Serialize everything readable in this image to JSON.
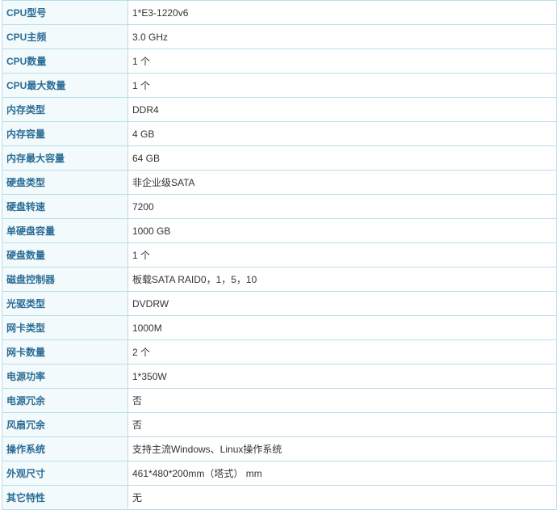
{
  "specs": [
    {
      "label": "CPU型号",
      "value": "1*E3-1220v6"
    },
    {
      "label": "CPU主频",
      "value": "3.0  GHz"
    },
    {
      "label": "CPU数量",
      "value": "1  个"
    },
    {
      "label": "CPU最大数量",
      "value": "1  个"
    },
    {
      "label": "内存类型",
      "value": "DDR4"
    },
    {
      "label": "内存容量",
      "value": "4  GB"
    },
    {
      "label": "内存最大容量",
      "value": "64  GB"
    },
    {
      "label": "硬盘类型",
      "value": "非企业级SATA"
    },
    {
      "label": "硬盘转速",
      "value": "7200"
    },
    {
      "label": "单硬盘容量",
      "value": "1000  GB"
    },
    {
      "label": "硬盘数量",
      "value": "1  个"
    },
    {
      "label": "磁盘控制器",
      "value": "板载SATA RAID0，1，5，10"
    },
    {
      "label": "光驱类型",
      "value": "DVDRW"
    },
    {
      "label": "网卡类型",
      "value": "1000M"
    },
    {
      "label": "网卡数量",
      "value": "2  个"
    },
    {
      "label": "电源功率",
      "value": "1*350W"
    },
    {
      "label": "电源冗余",
      "value": "否"
    },
    {
      "label": "风扇冗余",
      "value": "否"
    },
    {
      "label": "操作系统",
      "value": "支持主流Windows、Linux操作系统"
    },
    {
      "label": "外观尺寸",
      "value": "461*480*200mm（塔式）  mm"
    },
    {
      "label": "其它特性",
      "value": "无"
    }
  ]
}
